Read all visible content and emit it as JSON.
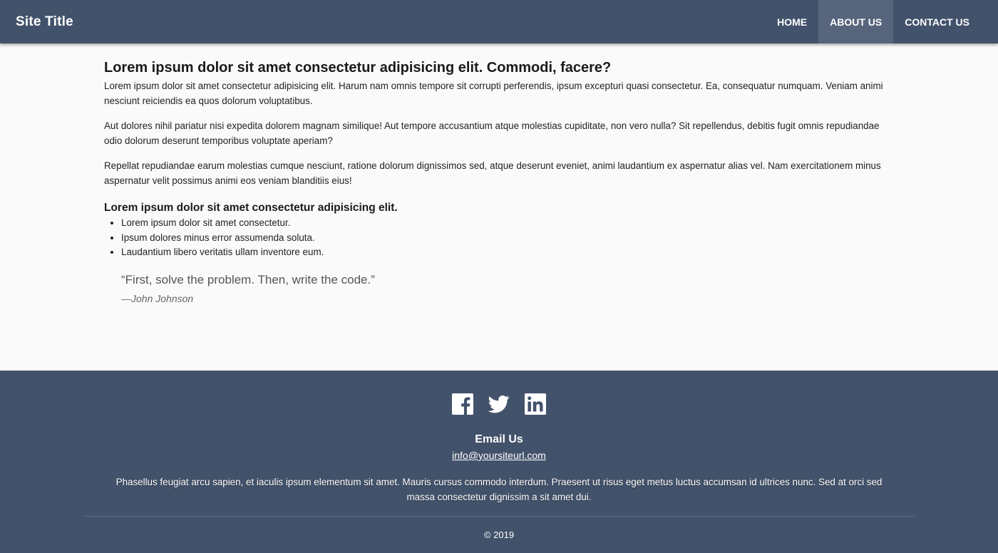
{
  "header": {
    "site_title": "Site Title",
    "nav": [
      {
        "label": "HOME",
        "active": false
      },
      {
        "label": "ABOUT US",
        "active": true
      },
      {
        "label": "CONTACT US",
        "active": false
      }
    ]
  },
  "main": {
    "title": "Lorem ipsum dolor sit amet consectetur adipisicing elit. Commodi, facere?",
    "paragraphs": [
      "Lorem ipsum dolor sit amet consectetur adipisicing elit. Harum nam omnis tempore sit corrupti perferendis, ipsum excepturi quasi consectetur. Ea, consequatur numquam. Veniam animi nesciunt reiciendis ea quos dolorum voluptatibus.",
      "Aut dolores nihil pariatur nisi expedita dolorem magnam similique! Aut tempore accusantium atque molestias cupiditate, non vero nulla? Sit repellendus, debitis fugit omnis repudiandae odio dolorum deserunt temporibus voluptate aperiam?",
      "Repellat repudiandae earum molestias cumque nesciunt, ratione dolorum dignissimos sed, atque deserunt eveniet, animi laudantium ex aspernatur alias vel. Nam exercitationem minus aspernatur velit possimus animi eos veniam blanditiis eius!"
    ],
    "list_heading": "Lorem ipsum dolor sit amet consectetur adipisicing elit.",
    "list_items": [
      "Lorem ipsum dolor sit amet consectetur.",
      "Ipsum dolores minus error assumenda soluta.",
      "Laudantium libero veritatis ullam inventore eum."
    ],
    "quote": {
      "text": "“First, solve the problem. Then, write the code.”",
      "author": "—John Johnson"
    }
  },
  "footer": {
    "socials": [
      {
        "name": "facebook-icon"
      },
      {
        "name": "twitter-icon"
      },
      {
        "name": "linkedin-icon"
      }
    ],
    "email_heading": "Email Us",
    "email": "info@yoursiteurl.com",
    "text": "Phasellus feugiat arcu sapien, et iaculis ipsum elementum sit amet. Mauris cursus commodo interdum. Praesent ut risus eget metus luctus accumsan id ultrices nunc. Sed at orci sed massa consectetur dignissim a sit amet dui.",
    "copyright": "© 2019"
  },
  "colors": {
    "header_bg": "#42526b",
    "nav_active_bg": "#56657c",
    "page_bg": "#fafafa",
    "footer_bg": "#42526b"
  }
}
